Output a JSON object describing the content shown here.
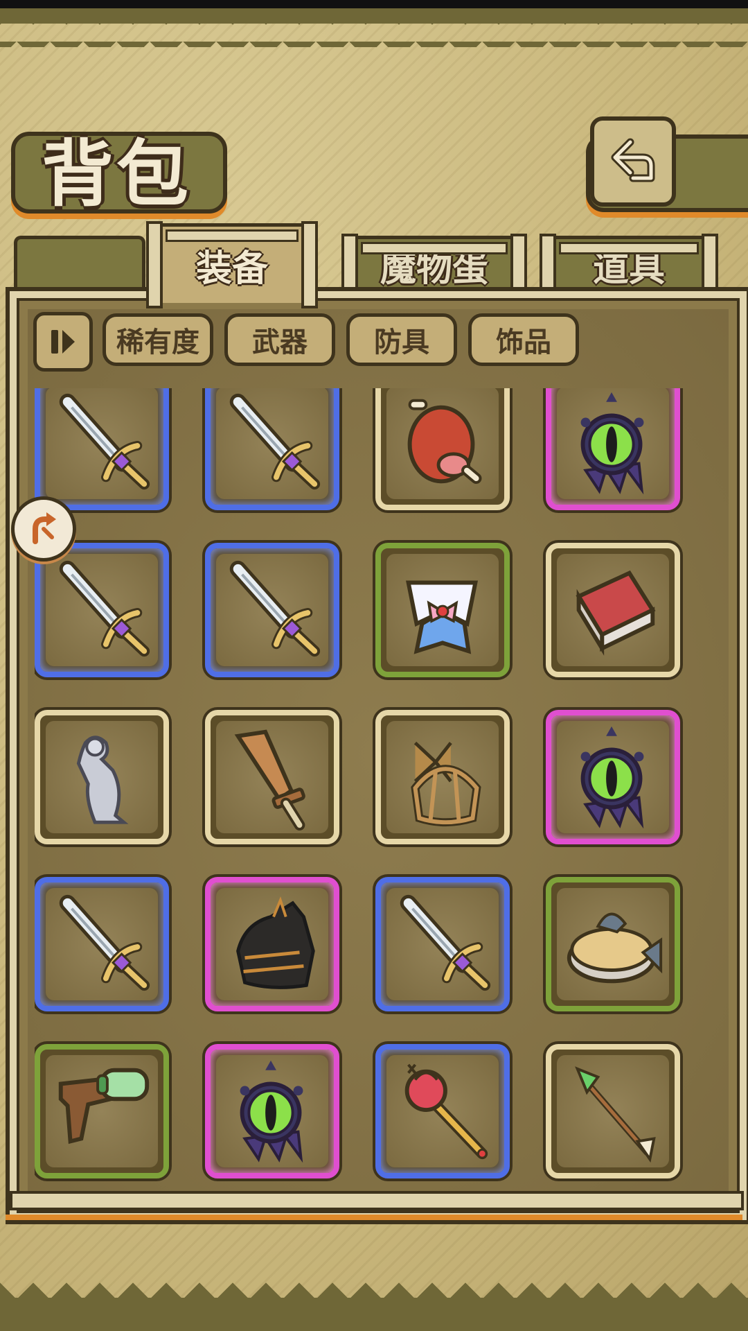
{
  "header": {
    "title": "背包"
  },
  "tabs": [
    {
      "label": "装备",
      "active": true
    },
    {
      "label": "魔物蛋",
      "active": false
    },
    {
      "label": "道具",
      "active": false
    }
  ],
  "filters": {
    "toggle_icon": "filter-toggle-icon",
    "chips": [
      "稀有度",
      "武器",
      "防具",
      "饰品"
    ]
  },
  "rarity_colors": {
    "common": "#e6d7a8",
    "uncommon": "#7ea23a",
    "rare": "#4f6ee6",
    "epic": "#e04fd0"
  },
  "inventory": {
    "rows": [
      [
        {
          "item": "sword-icon",
          "rarity": "rare"
        },
        {
          "item": "sword-icon",
          "rarity": "rare"
        },
        {
          "item": "meat-icon",
          "rarity": "common"
        },
        {
          "item": "eye-charm-icon",
          "rarity": "epic"
        }
      ],
      [
        {
          "item": "sword-icon",
          "rarity": "rare"
        },
        {
          "item": "sword-icon",
          "rarity": "rare"
        },
        {
          "item": "sailor-collar-icon",
          "rarity": "uncommon"
        },
        {
          "item": "brick-icon",
          "rarity": "common"
        }
      ],
      [
        {
          "item": "statue-icon",
          "rarity": "common"
        },
        {
          "item": "wooden-sword-icon",
          "rarity": "common"
        },
        {
          "item": "birdcage-icon",
          "rarity": "common"
        },
        {
          "item": "eye-charm-icon",
          "rarity": "epic"
        }
      ],
      [
        {
          "item": "sword-icon",
          "rarity": "rare"
        },
        {
          "item": "dark-armor-icon",
          "rarity": "epic"
        },
        {
          "item": "sword-icon",
          "rarity": "rare"
        },
        {
          "item": "fish-pie-icon",
          "rarity": "uncommon"
        }
      ],
      [
        {
          "item": "water-gun-icon",
          "rarity": "uncommon"
        },
        {
          "item": "eye-charm-icon",
          "rarity": "epic"
        },
        {
          "item": "scepter-icon",
          "rarity": "rare"
        },
        {
          "item": "arrow-icon",
          "rarity": "common"
        }
      ]
    ]
  }
}
